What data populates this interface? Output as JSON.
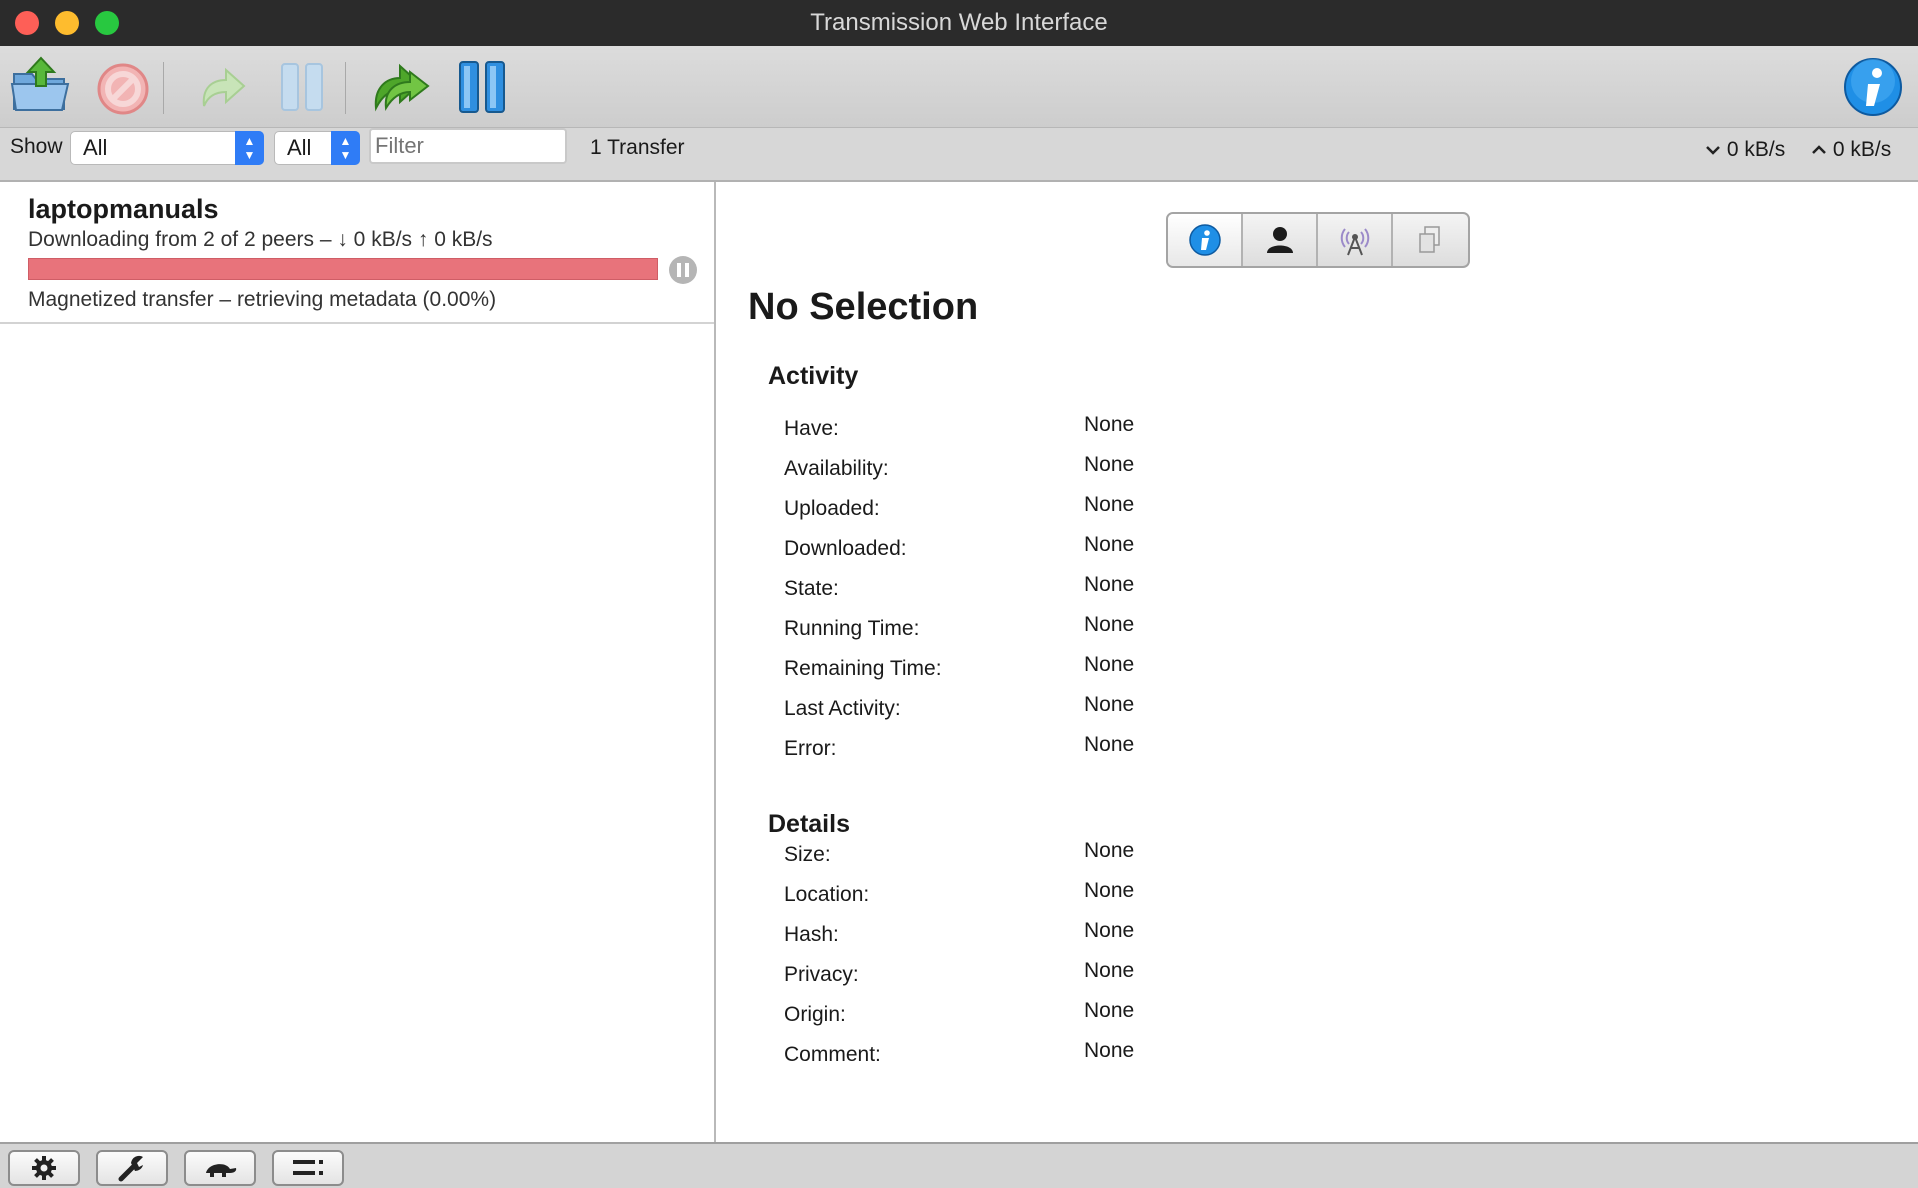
{
  "window": {
    "title": "Transmission Web Interface"
  },
  "toolbar": {
    "buttons": [
      {
        "name": "open-torrent-button",
        "icon": "folder-upload-icon"
      },
      {
        "name": "remove-torrent-button",
        "icon": "remove-icon"
      },
      {
        "name": "resume-selected-button",
        "icon": "resume-arrow-icon"
      },
      {
        "name": "pause-selected-button",
        "icon": "pause-icon"
      },
      {
        "name": "resume-all-button",
        "icon": "resume-all-arrow-icon"
      },
      {
        "name": "pause-all-button",
        "icon": "pause-all-icon"
      },
      {
        "name": "inspector-button",
        "icon": "info-icon"
      }
    ]
  },
  "filterbar": {
    "show_label": "Show",
    "state_filter": "All",
    "tracker_filter": "All",
    "filter_placeholder": "Filter",
    "transfer_count": "1 Transfer",
    "download_speed": "0 kB/s",
    "upload_speed": "0 kB/s"
  },
  "torrents": [
    {
      "name": "laptopmanuals",
      "peers": "Downloading from 2 of 2 peers – ↓ 0 kB/s ↑ 0 kB/s",
      "status": "Magnetized transfer – retrieving metadata (0.00%)",
      "progress_fraction": 0.0,
      "progress_color": "#e8737b"
    }
  ],
  "inspector": {
    "tabs": [
      "info-tab",
      "peers-tab",
      "trackers-tab",
      "files-tab"
    ],
    "heading": "No Selection",
    "activity": {
      "title": "Activity",
      "rows": [
        {
          "label": "Have:",
          "value": "None"
        },
        {
          "label": "Availability:",
          "value": "None"
        },
        {
          "label": "Uploaded:",
          "value": "None"
        },
        {
          "label": "Downloaded:",
          "value": "None"
        },
        {
          "label": "State:",
          "value": "None"
        },
        {
          "label": "Running Time:",
          "value": "None"
        },
        {
          "label": "Remaining Time:",
          "value": "None"
        },
        {
          "label": "Last Activity:",
          "value": "None"
        },
        {
          "label": "Error:",
          "value": "None"
        }
      ]
    },
    "details": {
      "title": "Details",
      "rows": [
        {
          "label": "Size:",
          "value": "None"
        },
        {
          "label": "Location:",
          "value": "None"
        },
        {
          "label": "Hash:",
          "value": "None"
        },
        {
          "label": "Privacy:",
          "value": "None"
        },
        {
          "label": "Origin:",
          "value": "None"
        },
        {
          "label": "Comment:",
          "value": "None"
        }
      ]
    }
  },
  "bottombar": {
    "buttons": [
      "settings-gear-icon",
      "preferences-wrench-icon",
      "turtle-speed-icon",
      "compact-view-icon"
    ]
  },
  "colors": {
    "accent": "#2f7cf6",
    "green_arrow": "#6dbf3a",
    "progress": "#e8737b"
  }
}
